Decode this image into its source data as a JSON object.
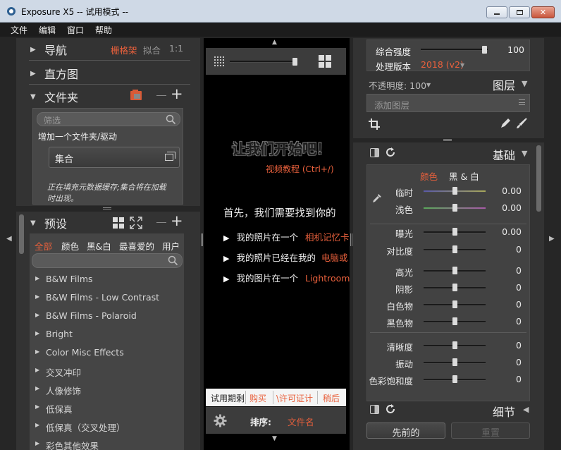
{
  "window": {
    "title": "Exposure X5 -- 试用模式 --",
    "min_icon": "minimize-icon",
    "max_icon": "maximize-icon",
    "close_icon": "close-icon"
  },
  "menu": [
    "文件",
    "编辑",
    "窗口",
    "帮助"
  ],
  "left": {
    "nav": {
      "label": "导航",
      "view_filmstrip": "栅格架",
      "view_fit": "拟合",
      "view_1to1": "1:1"
    },
    "histogram": {
      "label": "直方图"
    },
    "folders": {
      "label": "文件夹",
      "filter_placeholder": "筛选",
      "add_folder": "增加一个文件夹/驱动",
      "collection": "集合",
      "hint": "正在填充元数据缓存;集合将在加载时出现。"
    },
    "presets": {
      "label": "预设",
      "tabs": [
        "全部",
        "颜色",
        "黑&白",
        "最喜爱的",
        "用户"
      ],
      "items": [
        "B&W Films",
        "B&W Films - Low Contrast",
        "B&W Films - Polaroid",
        "Bright",
        "Color Misc Effects",
        "交叉冲印",
        "人像修饰",
        "低保真",
        "低保真（交叉处理）",
        "彩色其他效果"
      ]
    }
  },
  "center": {
    "welcome_title": "让我们开始吧！",
    "video_link": "视频教程 (Ctrl+/)",
    "first_text": "首先，我们需要找到你的",
    "options": [
      {
        "text": "我的照片在一个",
        "link": "相机记忆卡"
      },
      {
        "text": "我的照片已经在我的",
        "link": "电脑或"
      },
      {
        "text": "我的图片在一个",
        "link": "Lightroom|"
      }
    ],
    "trial": {
      "label": "试用期剩",
      "buy": "购买",
      "license": "\\许可证计",
      "later": "稍后"
    },
    "sort_label": "排序:",
    "sort_value": "文件名"
  },
  "right": {
    "overall_strength": {
      "label": "综合强度",
      "value": "100",
      "level": 0.95
    },
    "process_version": {
      "label": "处理版本",
      "value": "2018 (v2)"
    },
    "opacity": {
      "label": "不透明度: 100"
    },
    "layers": {
      "label": "图层",
      "add_layer": "添加图层"
    },
    "basic": {
      "label": "基础",
      "tab_color": "颜色",
      "tab_bw": "黑 & 白"
    },
    "adjustments": [
      {
        "name": "临时",
        "value": "0.00",
        "level": 0.5
      },
      {
        "name": "浅色",
        "value": "0.00",
        "level": 0.5
      },
      {
        "name": "曝光",
        "value": "0.00",
        "level": 0.5
      },
      {
        "name": "对比度",
        "value": "0",
        "level": 0.5
      },
      {
        "name": "高光",
        "value": "0",
        "level": 0.5
      },
      {
        "name": "阴影",
        "value": "0",
        "level": 0.5
      },
      {
        "name": "白色物",
        "value": "0",
        "level": 0.5
      },
      {
        "name": "黑色物",
        "value": "0",
        "level": 0.5
      },
      {
        "name": "清晰度",
        "value": "0",
        "level": 0.5
      },
      {
        "name": "振动",
        "value": "0",
        "level": 0.5
      },
      {
        "name": "色彩饱和度",
        "value": "0",
        "level": 0.5
      }
    ],
    "details": {
      "label": "细节"
    },
    "prev_button": "先前的",
    "reset_button": "重置"
  },
  "colors": {
    "accent": "#e8603c",
    "panel": "#333333",
    "background": "#262626"
  }
}
